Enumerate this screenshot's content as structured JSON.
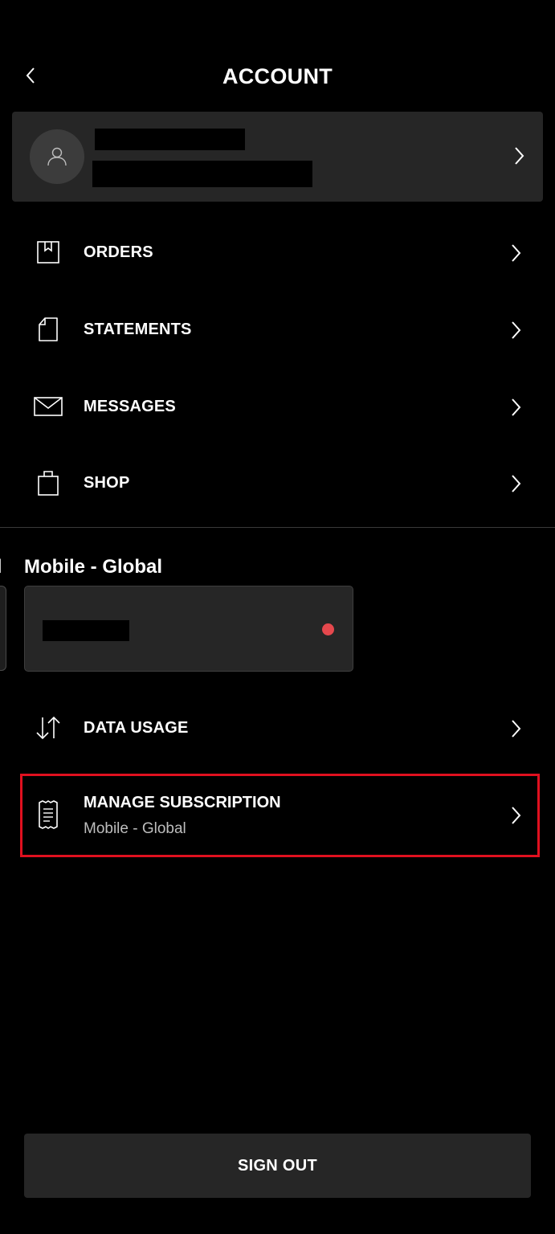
{
  "header": {
    "title": "ACCOUNT"
  },
  "icons": {
    "back": "chevron-left-icon",
    "chevron": "chevron-right-icon",
    "avatar": "user-icon"
  },
  "menu": {
    "items": [
      {
        "label": "ORDERS",
        "icon": "bookmark-box-icon"
      },
      {
        "label": "STATEMENTS",
        "icon": "document-icon"
      },
      {
        "label": "MESSAGES",
        "icon": "envelope-icon"
      },
      {
        "label": "SHOP",
        "icon": "shopping-bag-icon"
      }
    ]
  },
  "plan": {
    "title": "Mobile - Global",
    "prev_edge_label": "l",
    "status_color": "#e5484d"
  },
  "plan_menu": {
    "data_usage": {
      "label": "DATA USAGE",
      "icon": "arrows-up-down-icon"
    },
    "manage_subscription": {
      "label": "MANAGE SUBSCRIPTION",
      "sublabel": "Mobile - Global",
      "icon": "receipt-icon",
      "highlight_color": "#e0101f"
    }
  },
  "footer": {
    "sign_out_label": "SIGN OUT"
  }
}
